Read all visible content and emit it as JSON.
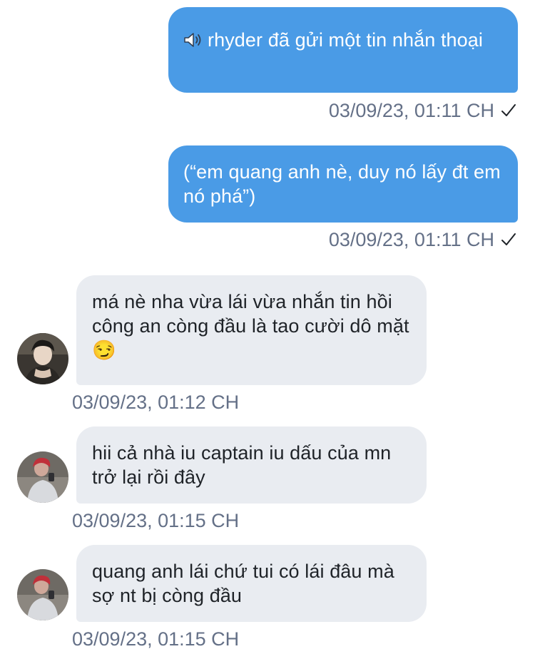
{
  "messages": [
    {
      "direction": "outgoing",
      "icon": "speaker-icon",
      "text": "rhyder đã gửi một tin nhắn thoại",
      "timestamp": "03/09/23, 01:11 CH",
      "status": "sent-check-icon"
    },
    {
      "direction": "outgoing",
      "text": "(“em quang anh nè, duy nó lấy đt em nó phá”)",
      "timestamp": "03/09/23, 01:11 CH",
      "status": "sent-check-icon"
    },
    {
      "direction": "incoming",
      "text": "má nè nha vừa lái vừa nhắn tin hồi công an còng đầu là tao cười dô mặt",
      "emoji": "😏",
      "timestamp": "03/09/23, 01:12 CH",
      "avatar": "avatar"
    },
    {
      "direction": "incoming",
      "text": "hii cả nhà iu captain iu dấu của mn trở lại rồi đây",
      "timestamp": "03/09/23, 01:15 CH",
      "avatar": "avatar"
    },
    {
      "direction": "incoming",
      "text": "quang anh lái chứ tui có lái đâu mà sợ nt bị còng đầu",
      "timestamp": "03/09/23, 01:15 CH",
      "avatar": "avatar"
    }
  ],
  "colors": {
    "outgoing_bubble": "#4a9be6",
    "incoming_bubble": "#e9ecf1",
    "timestamp_text": "#647087"
  }
}
